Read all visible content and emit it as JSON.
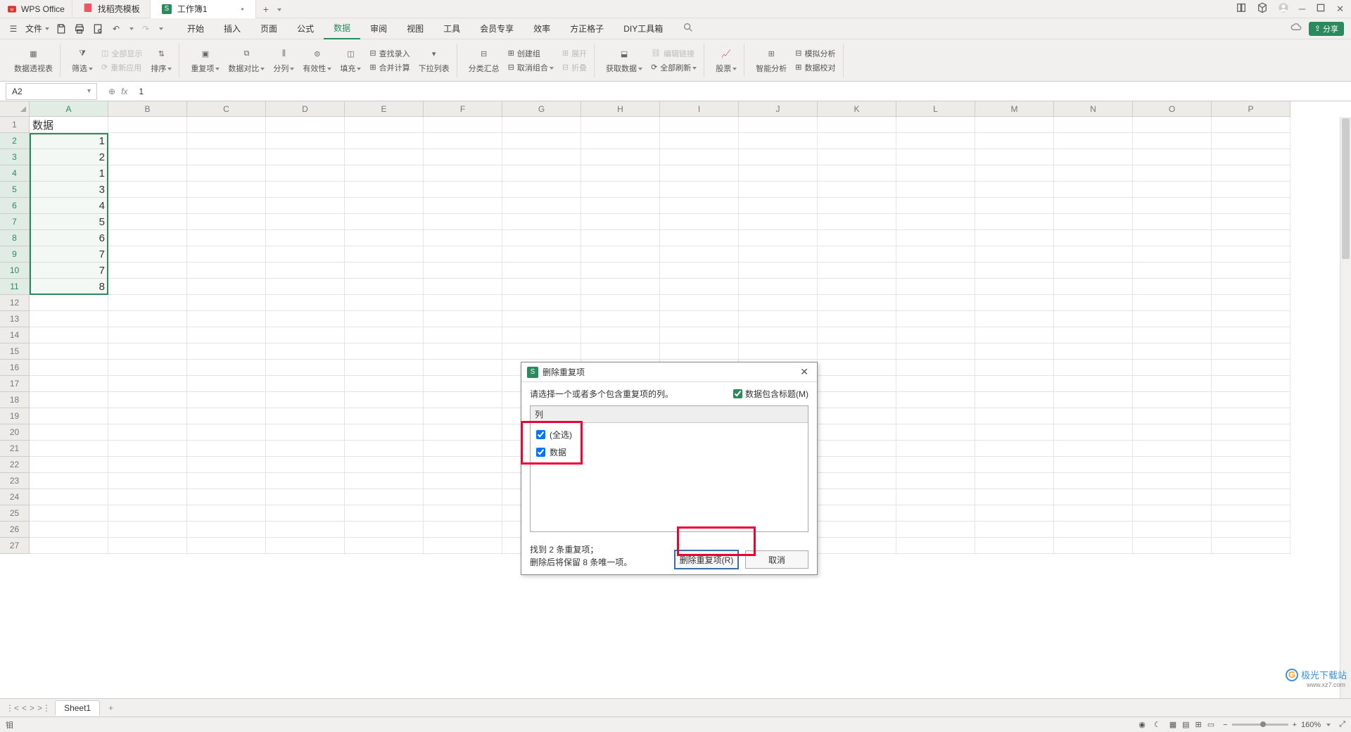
{
  "title_bar": {
    "app_name": "WPS Office",
    "template_tab": "找稻壳模板",
    "doc_tab": "工作簿1",
    "new_tab_icon": "+"
  },
  "menu_bar": {
    "file": "文件",
    "tabs": [
      "开始",
      "插入",
      "页面",
      "公式",
      "数据",
      "审阅",
      "视图",
      "工具",
      "会员专享",
      "效率",
      "方正格子",
      "DIY工具箱"
    ],
    "active_tab": "数据",
    "share": "分享"
  },
  "ribbon": {
    "pivot": "数据透视表",
    "filter": "筛选",
    "show_all": "全部显示",
    "reapply": "重新应用",
    "sort": "排序",
    "dup": "重复项",
    "compare": "数据对比",
    "split_col": "分列",
    "validation": "有效性",
    "fill": "填充",
    "lookup": "查找录入",
    "consolidate": "合并计算",
    "dropdown": "下拉列表",
    "subtotal": "分类汇总",
    "group": "创建组",
    "ungroup": "取消组合",
    "expand": "展开",
    "collapse": "折叠",
    "get_data": "获取数据",
    "edit_links": "编辑链接",
    "refresh_all": "全部刷新",
    "stocks": "股票",
    "smart_analysis": "智能分析",
    "simulation": "模拟分析",
    "data_valid": "数据校对"
  },
  "formula_bar": {
    "cell_ref": "A2",
    "fx": "fx",
    "value": "1"
  },
  "spreadsheet": {
    "columns": [
      "A",
      "B",
      "C",
      "D",
      "E",
      "F",
      "G",
      "H",
      "I",
      "J",
      "K",
      "L",
      "M",
      "N",
      "O",
      "P"
    ],
    "rows": [
      1,
      2,
      3,
      4,
      5,
      6,
      7,
      8,
      9,
      10,
      11,
      12,
      13,
      14,
      15,
      16,
      17,
      18,
      19,
      20,
      21,
      22,
      23,
      24,
      25,
      26,
      27
    ],
    "data": {
      "A1": "数据",
      "A2": "1",
      "A3": "2",
      "A4": "1",
      "A5": "3",
      "A6": "4",
      "A7": "5",
      "A8": "6",
      "A9": "7",
      "A10": "7",
      "A11": "8"
    },
    "sel_start_row": 2,
    "sel_end_row": 11
  },
  "dialog": {
    "title": "删除重复项",
    "prompt": "请选择一个或者多个包含重复项的列。",
    "has_header_label": "数据包含标题(M)",
    "col_header": "列",
    "select_all": "(全选)",
    "col_name": "数据",
    "found_line1": "找到 2 条重复项；",
    "found_line2": "删除后将保留 8 条唯一项。",
    "btn_remove": "删除重复项(R)",
    "btn_cancel": "取消"
  },
  "sheet_tabs": {
    "sheet1": "Sheet1"
  },
  "status_bar": {
    "indicator": "钼",
    "zoom": "160%"
  },
  "watermark": {
    "text": "极光下载站",
    "url": "www.xz7.com"
  },
  "chart_data": null
}
